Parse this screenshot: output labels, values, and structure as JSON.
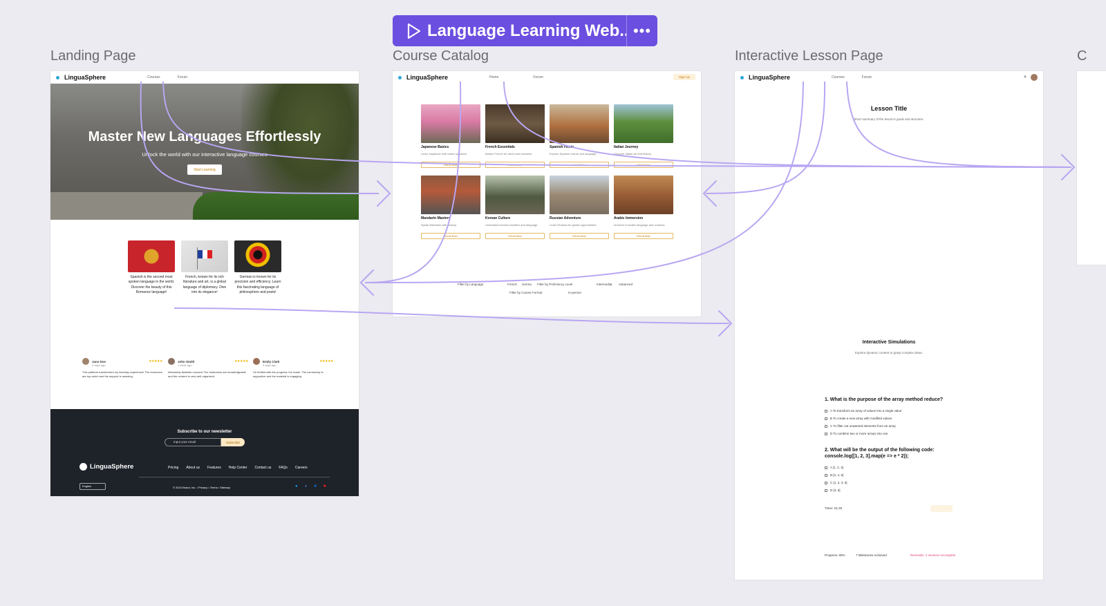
{
  "toolbar": {
    "flow_title": "Language Learning Web...",
    "more_label": "•••"
  },
  "frames": {
    "landing": "Landing Page",
    "catalog": "Course Catalog",
    "lesson": "Interactive Lesson Page",
    "next": "C"
  },
  "landing": {
    "brand": "LinguaSphere",
    "nav": [
      "Courses",
      "Forum"
    ],
    "hero_title": "Master New Languages Effortlessly",
    "hero_subtitle": "Unlock the world with our interactive language courses",
    "hero_cta": "Start Learning",
    "languages": [
      {
        "text": "Spanish is the second most spoken language in the world. Discover the beauty of this Romance language!"
      },
      {
        "text": "French, known for its rich literature and art, is a global language of diplomacy. Dive into its elegance!"
      },
      {
        "text": "German is known for its precision and efficiency. Learn this fascinating language of philosophers and poets!"
      }
    ],
    "reviews": [
      {
        "name": "Jane Doe",
        "ago": "2 days ago",
        "stars": "★★★★★",
        "text": "This platform transformed my learning experience! The resources are top-notch and the support is amazing."
      },
      {
        "name": "John Smith",
        "ago": "1 week ago",
        "stars": "★★★★★",
        "text": "Absolutely fantastic courses! The instructors are knowledgeable and the content is very well organized."
      },
      {
        "name": "Emily Clark",
        "ago": "3 days ago",
        "stars": "★★★★★",
        "text": "I'm thrilled with the progress I've made. The community is supportive and the material is engaging."
      }
    ],
    "newsletter_title": "Subscribe to our newsletter",
    "email_placeholder": "Input your email",
    "subscribe": "Subscribe",
    "footer_links": [
      "Pricing",
      "About us",
      "Features",
      "Help Center",
      "Contact us",
      "FAQs",
      "Careers"
    ],
    "language_select": "English",
    "copyright": "© 2024 Brand, Inc. • Privacy • Terms • Sitemap"
  },
  "catalog": {
    "brand": "LinguaSphere",
    "nav": [
      "Home",
      "Forum"
    ],
    "signup": "Sign Up",
    "courses": [
      {
        "title": "Japanese Basics",
        "desc": "Learn Japanese with native speakers.",
        "btn": "Enroll Now"
      },
      {
        "title": "French Essentials",
        "desc": "Master French for travel and business.",
        "btn": "Enroll Now"
      },
      {
        "title": "Spanish Fiesta",
        "desc": "Explore Spanish culture and language.",
        "btn": "Enroll Now"
      },
      {
        "title": "Italian Journey",
        "desc": "Discover Italian art and history.",
        "btn": "Enroll Now"
      },
      {
        "title": "Mandarin Mastery",
        "desc": "Speak Mandarin with fluency.",
        "btn": "Enroll Now"
      },
      {
        "title": "Korean Culture",
        "desc": "Understand Korean tradition and language.",
        "btn": "Enroll Now"
      },
      {
        "title": "Russian Adventure",
        "desc": "Learn Russian for global opportunities.",
        "btn": "Enroll Now"
      },
      {
        "title": "Arabic Immersion",
        "desc": "Immerse in Arabic language and customs.",
        "btn": "Enroll Now"
      }
    ],
    "filter_language": "Filter by Language",
    "filter_french": "French",
    "filter_german": "Germa",
    "filter_level": "Filter by Proficiency Level",
    "filter_intermediate": "Intermediat",
    "filter_advanced": "Advanced",
    "filter_format": "Filter by Course Format",
    "filter_inperson": "In-person"
  },
  "lesson": {
    "brand": "LinguaSphere",
    "nav": [
      "Courses",
      "Forum"
    ],
    "title": "Lesson Title",
    "summary": "Short summary of the lesson's goals and structure.",
    "sim_title": "Interactive Simulations",
    "sim_sub": "Explore dynamic content to grasp complex ideas.",
    "q1": "1. What is the purpose of the array method reduce?",
    "q1_options": [
      "A  To transform an array of values into a single value",
      "B  To create a new array with modified values",
      "C  To filter out unwanted elements from an array",
      "D  To combine two or more arrays into one"
    ],
    "q2": "2. What will be the output of the following code:",
    "q2_code": "console.log([1, 2, 3].map(e => e * 2));",
    "q2_options": [
      "A  [1, 2, 3]",
      "B  [2, 4, 6]",
      "C  [1, 2, 3, 6]",
      "D  [3, 6]"
    ],
    "timer": "Timer: 01:30",
    "progress": "Progress: 80%",
    "milestones": "7 Milestones Achieved",
    "reminder": "Reminder: 2 sections incomplete"
  },
  "colors": {
    "accent": "#6b4fe0",
    "flow": "#b8a6f2",
    "footer": "#1e2229",
    "gold": "#c47a00",
    "reminder": "#e0457b"
  }
}
